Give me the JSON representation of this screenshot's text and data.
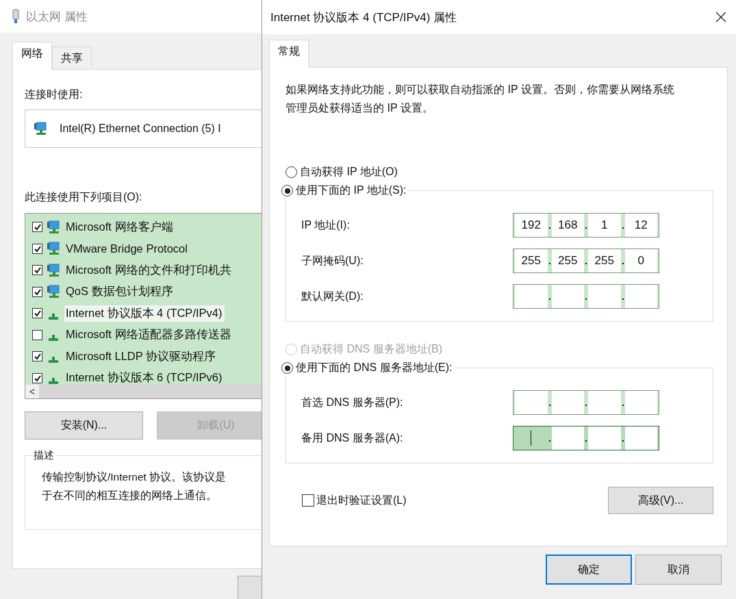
{
  "back_window": {
    "title": "以太网 属性",
    "tabs": [
      {
        "label": "网络",
        "selected": true
      },
      {
        "label": "共享",
        "selected": false
      }
    ],
    "connect_using_label": "连接时使用:",
    "adapter": "Intel(R) Ethernet Connection (5) I",
    "items_label": "此连接使用下列项目(O):",
    "items": [
      {
        "kind": "client",
        "label": "Microsoft 网络客户端",
        "checked": true,
        "selected": false
      },
      {
        "kind": "client",
        "label": "VMware Bridge Protocol",
        "checked": true,
        "selected": false
      },
      {
        "kind": "client",
        "label": "Microsoft 网络的文件和打印机共",
        "checked": true,
        "selected": false
      },
      {
        "kind": "client",
        "label": "QoS 数据包计划程序",
        "checked": true,
        "selected": false
      },
      {
        "kind": "protocol",
        "label": "Internet 协议版本 4 (TCP/IPv4)",
        "checked": true,
        "selected": true
      },
      {
        "kind": "protocol",
        "label": "Microsoft 网络适配器多路传送器",
        "checked": false,
        "selected": false
      },
      {
        "kind": "protocol",
        "label": "Microsoft LLDP 协议驱动程序",
        "checked": true,
        "selected": false
      },
      {
        "kind": "protocol",
        "label": "Internet 协议版本 6 (TCP/IPv6)",
        "checked": true,
        "selected": false
      }
    ],
    "scroll_arrow": "<",
    "buttons": [
      {
        "label": "安装(N)...",
        "disabled": false
      },
      {
        "label": "卸载(U)",
        "disabled": true
      }
    ],
    "description": {
      "title": "描述",
      "lines": [
        "传输控制协议/Internet 协议。该协议是",
        "于在不同的相互连接的网络上通信。"
      ]
    }
  },
  "front_window": {
    "title": "Internet 协议版本 4 (TCP/IPv4) 属性",
    "tabs": [
      {
        "label": "常规",
        "selected": true
      }
    ],
    "intro": "如果网络支持此功能，则可以获取自动指派的 IP 设置。否则，你需要从网络系统管理员处获得适当的 IP 设置。",
    "ip_options": [
      {
        "label": "自动获得 IP 地址(O)",
        "selected": false,
        "disabled": false
      },
      {
        "label": "使用下面的 IP 地址(S):",
        "selected": true,
        "disabled": false
      }
    ],
    "ip_fields": [
      {
        "label": "IP 地址(I):",
        "octets": [
          "192",
          "168",
          "1",
          "12"
        ],
        "focused": false
      },
      {
        "label": "子网掩码(U):",
        "octets": [
          "255",
          "255",
          "255",
          "0"
        ],
        "focused": false
      },
      {
        "label": "默认网关(D):",
        "focused": false
      }
    ],
    "dns_options": [
      {
        "label": "自动获得 DNS 服务器地址(B)",
        "selected": false,
        "disabled": true
      },
      {
        "label": "使用下面的 DNS 服务器地址(E):",
        "selected": true,
        "disabled": false
      }
    ],
    "dns_fields": [
      {
        "label": "首选 DNS 服务器(P):",
        "focused": false
      },
      {
        "label": "备用 DNS 服务器(A):",
        "focused": true
      }
    ],
    "validate": {
      "label": "退出时验证设置(L)",
      "checked": false
    },
    "advanced_button": "高级(V)...",
    "buttons": [
      {
        "label": "确定",
        "default": true
      },
      {
        "label": "取消",
        "default": false
      }
    ]
  }
}
